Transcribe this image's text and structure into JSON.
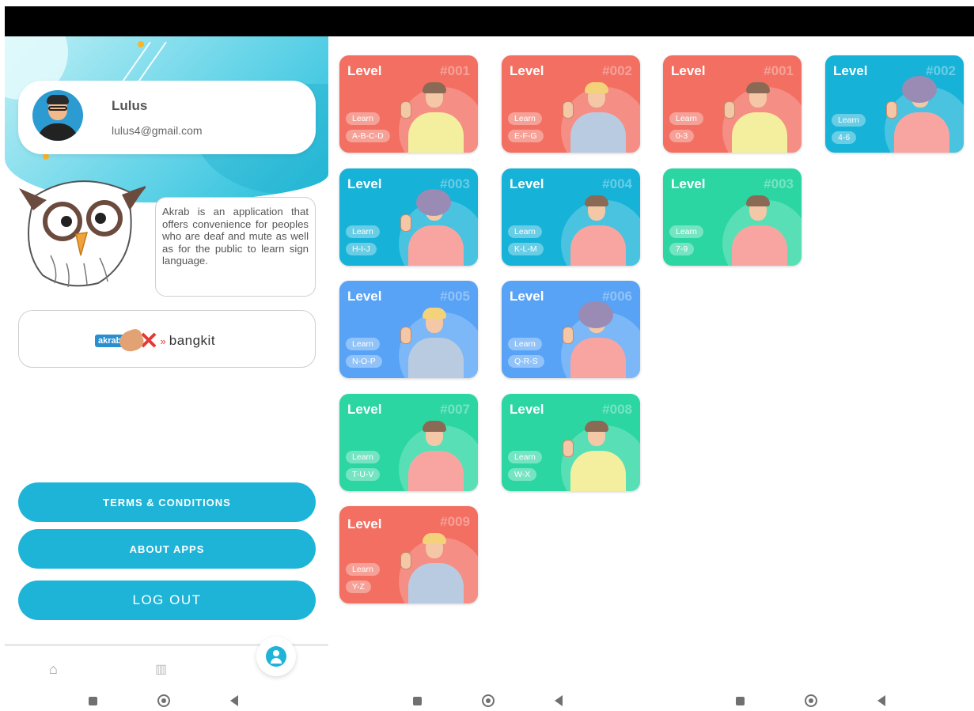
{
  "profile": {
    "user_name": "Lulus",
    "user_email": "lulus4@gmail.com",
    "about_text": "Akrab is an application that offers convenience for peoples who are deaf and mute as well as for the public to learn sign language.",
    "logo": {
      "akrab": "akrab",
      "bangkit": "bangkit"
    },
    "buttons": {
      "terms": "TERMS & CONDITIONS",
      "about": "ABOUT APPS",
      "logout": "LOG OUT"
    }
  },
  "nav": {
    "items": [
      "home-icon",
      "book-icon",
      "profile-icon"
    ],
    "active": "profile"
  },
  "cards": [
    {
      "level": "Level",
      "num": "#001",
      "learn": "Learn",
      "range": "A-B-C-D",
      "color": "#f26f62"
    },
    {
      "level": "Level",
      "num": "#002",
      "learn": "Learn",
      "range": "E-F-G",
      "color": "#f26f62"
    },
    {
      "level": "Level",
      "num": "#001",
      "learn": "Learn",
      "range": "0-3",
      "color": "#f26f62"
    },
    {
      "level": "Level",
      "num": "#002",
      "learn": "Learn",
      "range": "4-6",
      "color": "#17b2d8"
    },
    {
      "level": "Level",
      "num": "#003",
      "learn": "Learn",
      "range": "H-I-J",
      "color": "#17b2d8"
    },
    {
      "level": "Level",
      "num": "#004",
      "learn": "Learn",
      "range": "K-L-M",
      "color": "#17b2d8"
    },
    {
      "level": "Level",
      "num": "#003",
      "learn": "Learn",
      "range": "7-9",
      "color": "#2bd6a2"
    },
    {
      "level": "Level",
      "num": "#005",
      "learn": "Learn",
      "range": "N-O-P",
      "color": "#58a3f5"
    },
    {
      "level": "Level",
      "num": "#006",
      "learn": "Learn",
      "range": "Q-R-S",
      "color": "#58a3f5"
    },
    {
      "level": "Level",
      "num": "#007",
      "learn": "Learn",
      "range": "T-U-V",
      "color": "#2bd6a2"
    },
    {
      "level": "Level",
      "num": "#008",
      "learn": "Learn",
      "range": "W-X",
      "color": "#2bd6a2"
    },
    {
      "level": "Level",
      "num": "#009",
      "learn": "Learn",
      "range": "Y-Z",
      "color": "#f26f62"
    }
  ]
}
